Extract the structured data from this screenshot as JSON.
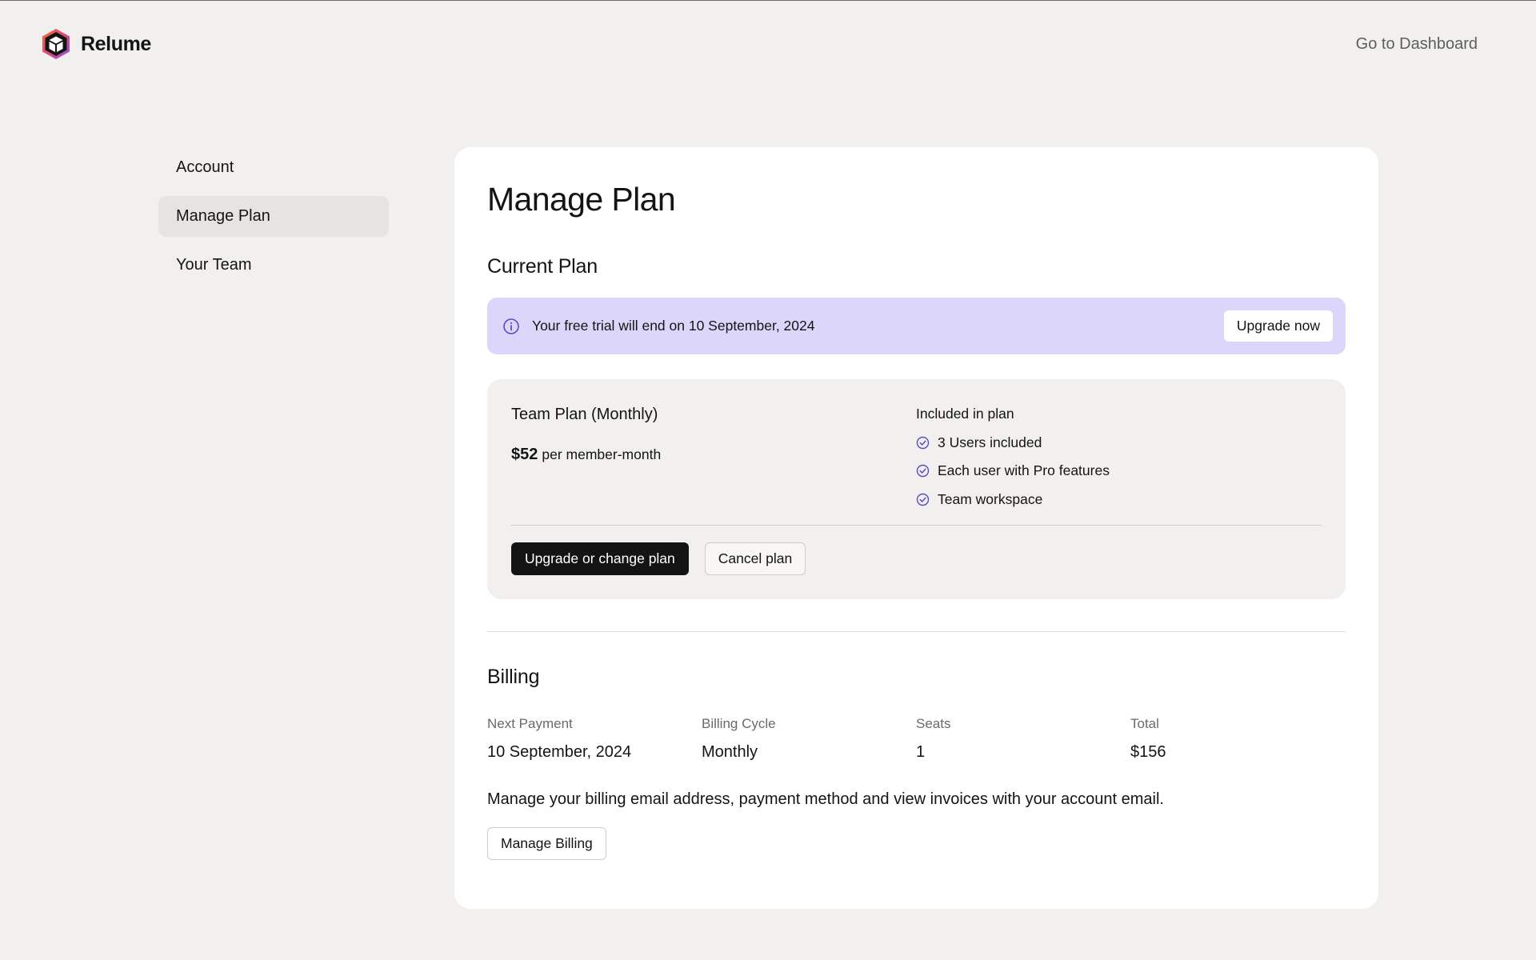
{
  "header": {
    "brand_name": "Relume",
    "dashboard_link": "Go to Dashboard"
  },
  "sidebar": {
    "items": [
      {
        "label": "Account",
        "active": false
      },
      {
        "label": "Manage Plan",
        "active": true
      },
      {
        "label": "Your Team",
        "active": false
      }
    ]
  },
  "main": {
    "title": "Manage Plan",
    "current_plan": {
      "heading": "Current Plan",
      "trial_banner": {
        "icon": "info-icon",
        "text": "Your free trial will end on 10 September, 2024",
        "button_label": "Upgrade now"
      },
      "plan": {
        "name": "Team Plan (Monthly)",
        "price": "$52",
        "price_unit": "per member-month",
        "included_title": "Included in plan",
        "features": [
          "3 Users included",
          "Each user with Pro features",
          "Team workspace"
        ],
        "primary_button": "Upgrade or change plan",
        "secondary_button": "Cancel plan"
      }
    },
    "billing": {
      "heading": "Billing",
      "columns": [
        {
          "label": "Next Payment",
          "value": "10 September, 2024"
        },
        {
          "label": "Billing Cycle",
          "value": "Monthly"
        },
        {
          "label": "Seats",
          "value": "1"
        },
        {
          "label": "Total",
          "value": "$156"
        }
      ],
      "note": "Manage your billing email address, payment method and view invoices with your account email.",
      "button_label": "Manage Billing"
    }
  },
  "colors": {
    "background": "#f1f0ee",
    "card": "#ffffff",
    "banner": "#dcd6fa",
    "accent_icon": "#5b4bc4",
    "primary_button": "#141414"
  }
}
